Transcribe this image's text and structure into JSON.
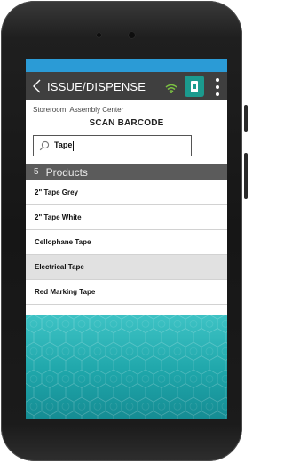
{
  "appbar": {
    "title": "ISSUE/DISPENSE"
  },
  "header": {
    "storeroom": "Storeroom: Assembly Center",
    "scan_title": "SCAN BARCODE"
  },
  "search": {
    "value": "Tape"
  },
  "products": {
    "count": "5",
    "label": "Products",
    "items": [
      {
        "label": "2\" Tape Grey"
      },
      {
        "label": "2\"  Tape White"
      },
      {
        "label": "Cellophane Tape"
      },
      {
        "label": "Electrical Tape",
        "selected": true
      },
      {
        "label": "Red Marking Tape"
      }
    ]
  },
  "colors": {
    "statusbar": "#2b9bd6",
    "appbar": "#3f3f3f",
    "accent_teal": "#1b9a8e",
    "wifi_green": "#7bc142",
    "background_teal": "#1fa6aa"
  },
  "icons": {
    "back": "chevron-left-icon",
    "wifi": "wifi-icon",
    "device": "device-icon",
    "menu": "more-vert-icon",
    "search": "search-icon"
  }
}
